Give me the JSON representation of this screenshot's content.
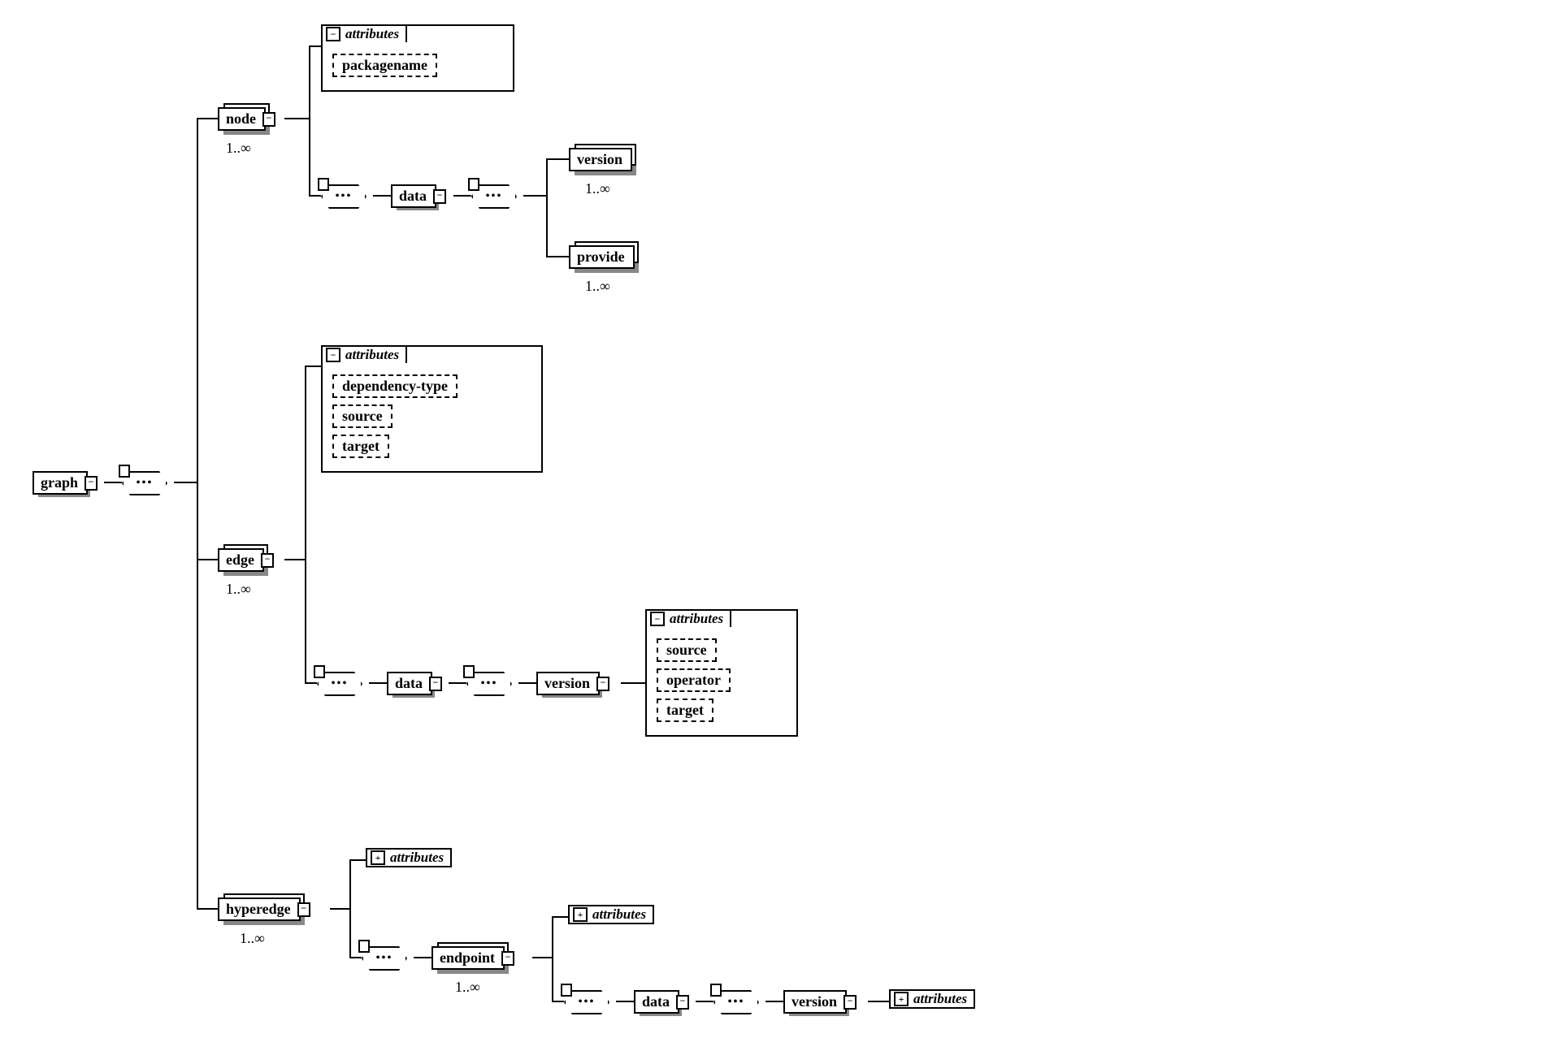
{
  "root": {
    "label": "graph"
  },
  "node": {
    "label": "node",
    "card": "1..∞",
    "attributes_label": "attributes",
    "attributes": {
      "packagename": "packagename"
    },
    "data_label": "data",
    "children": {
      "version": {
        "label": "version",
        "card": "1..∞"
      },
      "provide": {
        "label": "provide",
        "card": "1..∞"
      }
    }
  },
  "edge": {
    "label": "edge",
    "card": "1..∞",
    "attributes_label": "attributes",
    "attributes": {
      "dependency_type": "dependency-type",
      "source": "source",
      "target": "target"
    },
    "data_label": "data",
    "version_label": "version",
    "version_attributes_label": "attributes",
    "version_attributes": {
      "source": "source",
      "operator": "operator",
      "target": "target"
    }
  },
  "hyperedge": {
    "label": "hyperedge",
    "card": "1..∞",
    "attributes_label": "attributes",
    "endpoint": {
      "label": "endpoint",
      "card": "1..∞",
      "attributes_label": "attributes",
      "data_label": "data",
      "version_label": "version",
      "version_attributes_label": "attributes"
    }
  }
}
